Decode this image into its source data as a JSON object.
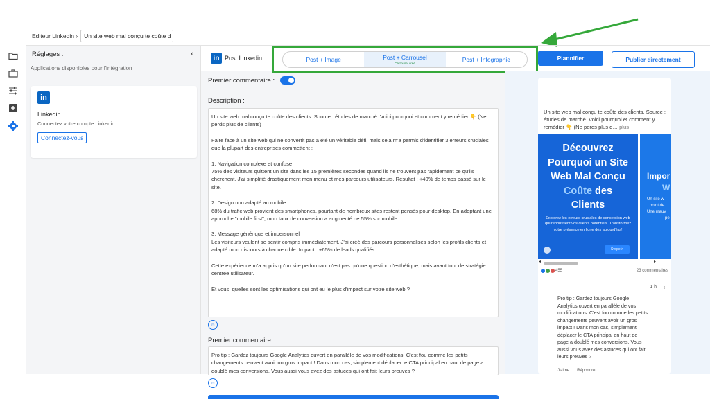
{
  "topbar": {
    "breadcrumb": "Editeur Linkedin ›",
    "title_value": "Un site web mal conçu te coûte d"
  },
  "settings": {
    "heading": "Réglages :",
    "subtitle": "Applications disponibles pour l'intégration",
    "card": {
      "logo": "in",
      "name": "Linkedin",
      "description": "Connectez votre compte Linkedin",
      "button": "Connectez-vous"
    }
  },
  "editor": {
    "platform_logo": "in",
    "platform_label": "Post Linkedin",
    "tabs": [
      {
        "label": "Post + Image",
        "sub": ""
      },
      {
        "label": "Post + Carrousel",
        "sub": "Carrousel créé"
      },
      {
        "label": "Post + Infographie",
        "sub": ""
      }
    ],
    "premier_commentaire_toggle_label": "Premier commentaire :",
    "description_label": "Description :",
    "description": [
      "Un site web mal conçu te coûte des clients. Source : études de marché. Voici pourquoi et comment y remédier 👇 (Ne perds plus de clients)",
      "Faire face à un site web qui ne convertit pas a été un véritable défi, mais cela m'a permis d'identifier 3 erreurs cruciales que la plupart des entreprises commettent :",
      "1. Navigation complexe et confuse",
      "75% des visiteurs quittent un site dans les 15 premières secondes quand ils ne trouvent pas rapidement ce qu'ils cherchent. J'ai simplifié drastiquement mon menu et mes parcours utilisateurs. Résultat : +40% de temps passé sur le site.",
      "2. Design non adapté au mobile",
      "68% du trafic web provient des smartphones, pourtant de nombreux sites restent pensés pour desktop. En adoptant une approche \"mobile first\", mon taux de conversion a augmenté de 55% sur mobile.",
      "3. Message générique et impersonnel",
      "Les visiteurs veulent se sentir compris immédiatement. J'ai créé des parcours personnalisés selon les profils clients et adapté mon discours à chaque cible. Impact : +65% de leads qualifiés.",
      "Cette expérience m'a appris qu'un site performant n'est pas qu'une question d'esthétique, mais avant tout de stratégie centrée utilisateur.",
      "Et vous, quelles sont les optimisations qui ont eu le plus d'impact sur votre site web ?"
    ],
    "premier_commentaire_label": "Premier commentaire :",
    "premier_commentaire": "Pro tip : Gardez toujours Google Analytics ouvert en parallèle de vos modifications. C'est fou comme les petits changements peuvent avoir un gros impact ! Dans mon cas, simplement déplacer le CTA principal en haut de page a doublé mes conversions. Vous aussi vous avez des astuces qui ont fait leurs preuves ?"
  },
  "actions": {
    "plan": "Plannifier",
    "publish": "Publier directement"
  },
  "preview": {
    "text": "Un site web mal conçu te coûte des clients. Source : études de marché. Voici pourquoi et comment y remédier 👇 (Ne perds plus d…",
    "more": "plus",
    "slide1": {
      "line1": "Découvrez",
      "line2": "Pourquoi un Site",
      "line3": "Web Mal Conçu",
      "accent": "Coûte",
      "line4_rest": " des",
      "line5": "Clients",
      "small": "Explorez les erreurs cruciales de conception web qui repoussent vos clients potentiels. Transformez votre présence en ligne dès aujourd'hui!",
      "next": "Swipe >"
    },
    "slide2": {
      "line1": "Impor",
      "accent": "W",
      "small1": "Un site w",
      "small2": "point de",
      "small3": "Une mauv",
      "small4": "pe"
    },
    "reaction_count": "455",
    "comments_count": "23 commentaires",
    "comment_time": "1 h",
    "comment_menu": "⋮",
    "comment": "Pro tip : Gardez toujours Google Analytics ouvert en parallèle de vos modifications. C'est fou comme les petits changements peuvent avoir un gros impact ! Dans mon cas, simplement déplacer le CTA principal en haut de page a doublé mes conversions. Vous aussi vous avez des astuces qui ont fait leurs preuves ?",
    "like": "J'aime",
    "reply": "Répondre",
    "separator": "|"
  },
  "colors": {
    "accent": "#1a73e8",
    "highlight_box": "#35a83a",
    "linkedin": "#0a66c2"
  }
}
